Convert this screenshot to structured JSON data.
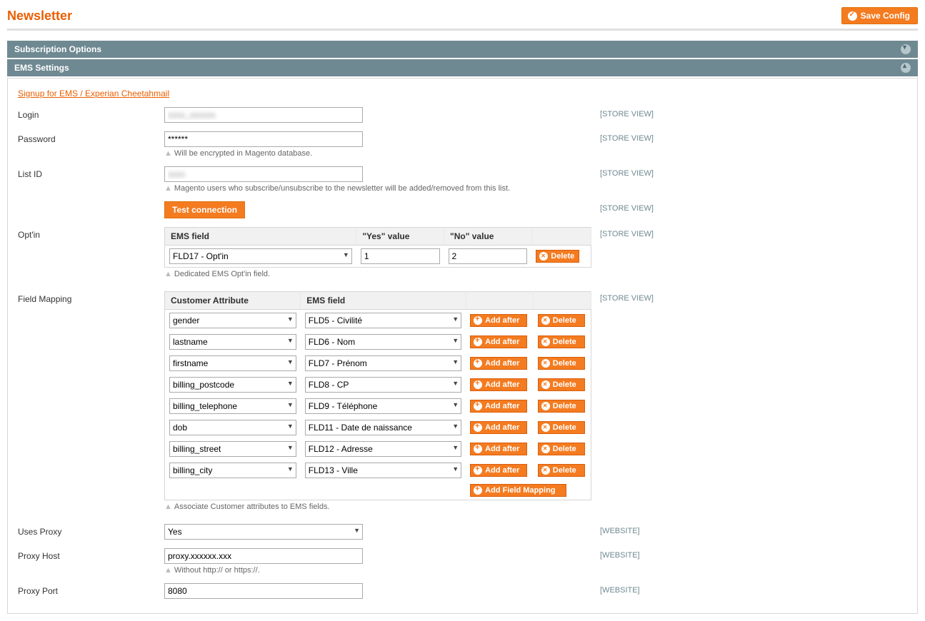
{
  "page": {
    "title": "Newsletter",
    "save_config": "Save Config"
  },
  "sections": {
    "subscription": {
      "title": "Subscription Options"
    },
    "ems": {
      "title": "EMS Settings"
    }
  },
  "signup_link": "Signup for EMS / Experian Cheetahmail",
  "scopes": {
    "store_view": "[STORE VIEW]",
    "website": "[WEBSITE]"
  },
  "buttons": {
    "test_connection": "Test connection",
    "add_after": "Add after",
    "delete": "Delete",
    "add_field_mapping": "Add Field Mapping"
  },
  "fields": {
    "login": {
      "label": "Login",
      "value": "xxxx_xxxxxx"
    },
    "password": {
      "label": "Password",
      "value": "******",
      "hint": "Will be encrypted in Magento database."
    },
    "list_id": {
      "label": "List ID",
      "value": "xxxx",
      "hint": "Magento users who subscribe/unsubscribe to the newsletter will be added/removed from this list."
    },
    "optin": {
      "label": "Opt'in",
      "headers": {
        "ems_field": "EMS field",
        "yes": "\"Yes\" value",
        "no": "\"No\" value"
      },
      "ems_field": "FLD17 - Opt'in",
      "yes_value": "1",
      "no_value": "2",
      "hint": "Dedicated EMS Opt'in field."
    },
    "field_mapping": {
      "label": "Field Mapping",
      "headers": {
        "customer_attr": "Customer Attribute",
        "ems_field": "EMS field"
      },
      "rows": [
        {
          "attr": "gender",
          "ems": "FLD5 - Civilité"
        },
        {
          "attr": "lastname",
          "ems": "FLD6 - Nom"
        },
        {
          "attr": "firstname",
          "ems": "FLD7 - Prénom"
        },
        {
          "attr": "billing_postcode",
          "ems": "FLD8 - CP"
        },
        {
          "attr": "billing_telephone",
          "ems": "FLD9 - Téléphone"
        },
        {
          "attr": "dob",
          "ems": "FLD11 - Date de naissance"
        },
        {
          "attr": "billing_street",
          "ems": "FLD12 - Adresse"
        },
        {
          "attr": "billing_city",
          "ems": "FLD13 - Ville"
        }
      ],
      "hint": "Associate Customer attributes to EMS fields."
    },
    "uses_proxy": {
      "label": "Uses Proxy",
      "value": "Yes"
    },
    "proxy_host": {
      "label": "Proxy Host",
      "value": "proxy.xxxxxx.xxx",
      "hint": "Without http:// or https://."
    },
    "proxy_port": {
      "label": "Proxy Port",
      "value": "8080"
    }
  }
}
